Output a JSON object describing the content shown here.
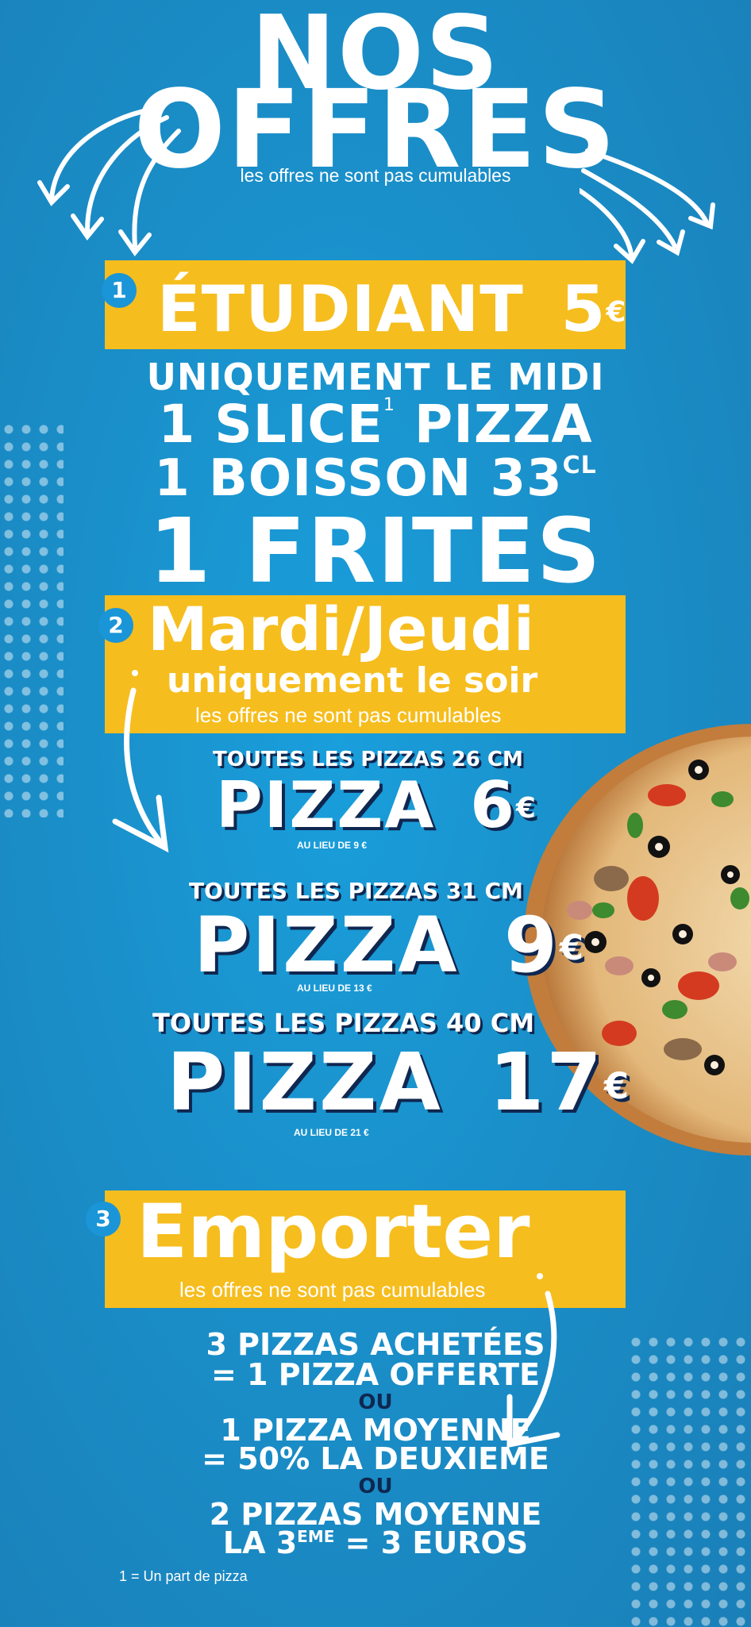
{
  "title": {
    "line1": "NOS",
    "line2": "OFFRES",
    "subtitle": "les offres ne sont pas cumulables"
  },
  "offer1": {
    "number": "1",
    "title": "ÉTUDIANT",
    "price": "5",
    "currency": "€",
    "lines": [
      "UNIQUEMENT LE MIDI",
      "1 SLICE",
      "PIZZA",
      "1 BOISSON 33",
      "CL",
      "1 FRITES"
    ],
    "footnote_mark": "1"
  },
  "offer2": {
    "number": "2",
    "title": "Mardi/Jeudi",
    "subtitle": "uniquement le soir",
    "note": "les offres ne sont pas cumulables",
    "items": [
      {
        "size": "TOUTES LES PIZZAS 26 CM",
        "label": "PIZZA",
        "price": "6",
        "currency": "€",
        "was": "AU LIEU DE 9 €"
      },
      {
        "size": "TOUTES LES PIZZAS 31 CM",
        "label": "PIZZA",
        "price": "9",
        "currency": "€",
        "was": "AU LIEU DE 13 €"
      },
      {
        "size": "TOUTES LES PIZZAS 40 CM",
        "label": "PIZZA",
        "price": "17",
        "currency": "€",
        "was": "AU LIEU DE 21 €"
      }
    ]
  },
  "offer3": {
    "number": "3",
    "title": "Emporter",
    "note": "les offres ne sont pas cumulables",
    "deal1": {
      "line1": "3 PIZZAS ACHETÉES",
      "line2": "= 1 PIZZA OFFERTE"
    },
    "or1": "OU",
    "deal2": {
      "line1": "1 PIZZA MOYENNE",
      "line2": "= 50% LA DEUXIEME"
    },
    "or2": "OU",
    "deal3": {
      "line1": "2 PIZZAS MOYENNE",
      "line2a": "LA 3",
      "line2_sup": "EME",
      "line2b": " = 3 EUROS"
    }
  },
  "footnote": "1 = Un part de pizza",
  "colors": {
    "background": "#1a8fc9",
    "band": "#f6bd1e",
    "badge": "#1a95d7",
    "shadow": "#0f2750"
  },
  "icons": [
    "curved-arrow-icon",
    "pizza-image"
  ]
}
